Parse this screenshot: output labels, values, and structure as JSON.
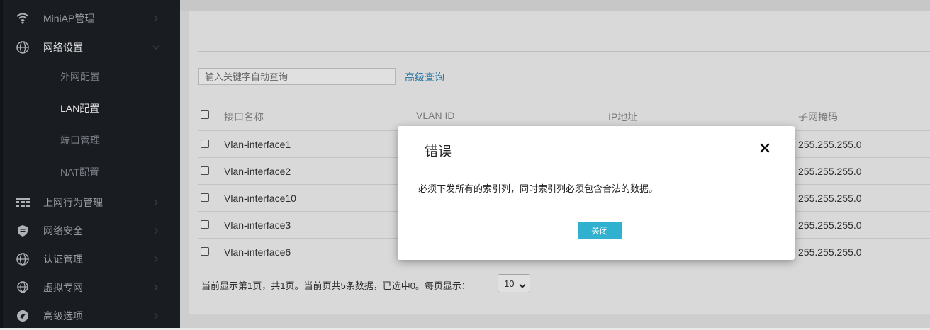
{
  "sidebar": {
    "items": [
      {
        "label": "MiniAP管理",
        "icon": "wifi-icon"
      },
      {
        "label": "网络设置",
        "icon": "globe-icon",
        "expanded": true
      },
      {
        "label": "上网行为管理",
        "icon": "grid-icon"
      },
      {
        "label": "网络安全",
        "icon": "shield-icon"
      },
      {
        "label": "认证管理",
        "icon": "globe-icon"
      },
      {
        "label": "虚拟专网",
        "icon": "vpn-globe-icon"
      },
      {
        "label": "高级选项",
        "icon": "advanced-icon"
      }
    ],
    "sub_items": [
      {
        "label": "外网配置"
      },
      {
        "label": "LAN配置",
        "current": true
      },
      {
        "label": "端口管理"
      },
      {
        "label": "NAT配置"
      }
    ]
  },
  "search": {
    "placeholder": "输入关键字自动查询",
    "advanced_label": "高级查询"
  },
  "table": {
    "headers": [
      "接口名称",
      "VLAN ID",
      "IP地址",
      "子网掩码"
    ],
    "rows": [
      {
        "name": "Vlan-interface1",
        "mask": "255.255.255.0"
      },
      {
        "name": "Vlan-interface2",
        "mask": "255.255.255.0"
      },
      {
        "name": "Vlan-interface10",
        "mask": "255.255.255.0"
      },
      {
        "name": "Vlan-interface3",
        "mask": "255.255.255.0"
      },
      {
        "name": "Vlan-interface6",
        "mask": "255.255.255.0"
      }
    ]
  },
  "pagination": {
    "summary": "当前显示第1页，共1页。当前页共5条数据，已选中0。每页显示：",
    "page_size": "10"
  },
  "modal": {
    "title": "错误",
    "message": "必须下发所有的索引列，同时索引列必须包含合法的数据。",
    "close_button": "关闭"
  },
  "colors": {
    "sidebar_bg": "#1d2026",
    "accent_button": "#2fb1cf",
    "link": "#2a84b8"
  }
}
